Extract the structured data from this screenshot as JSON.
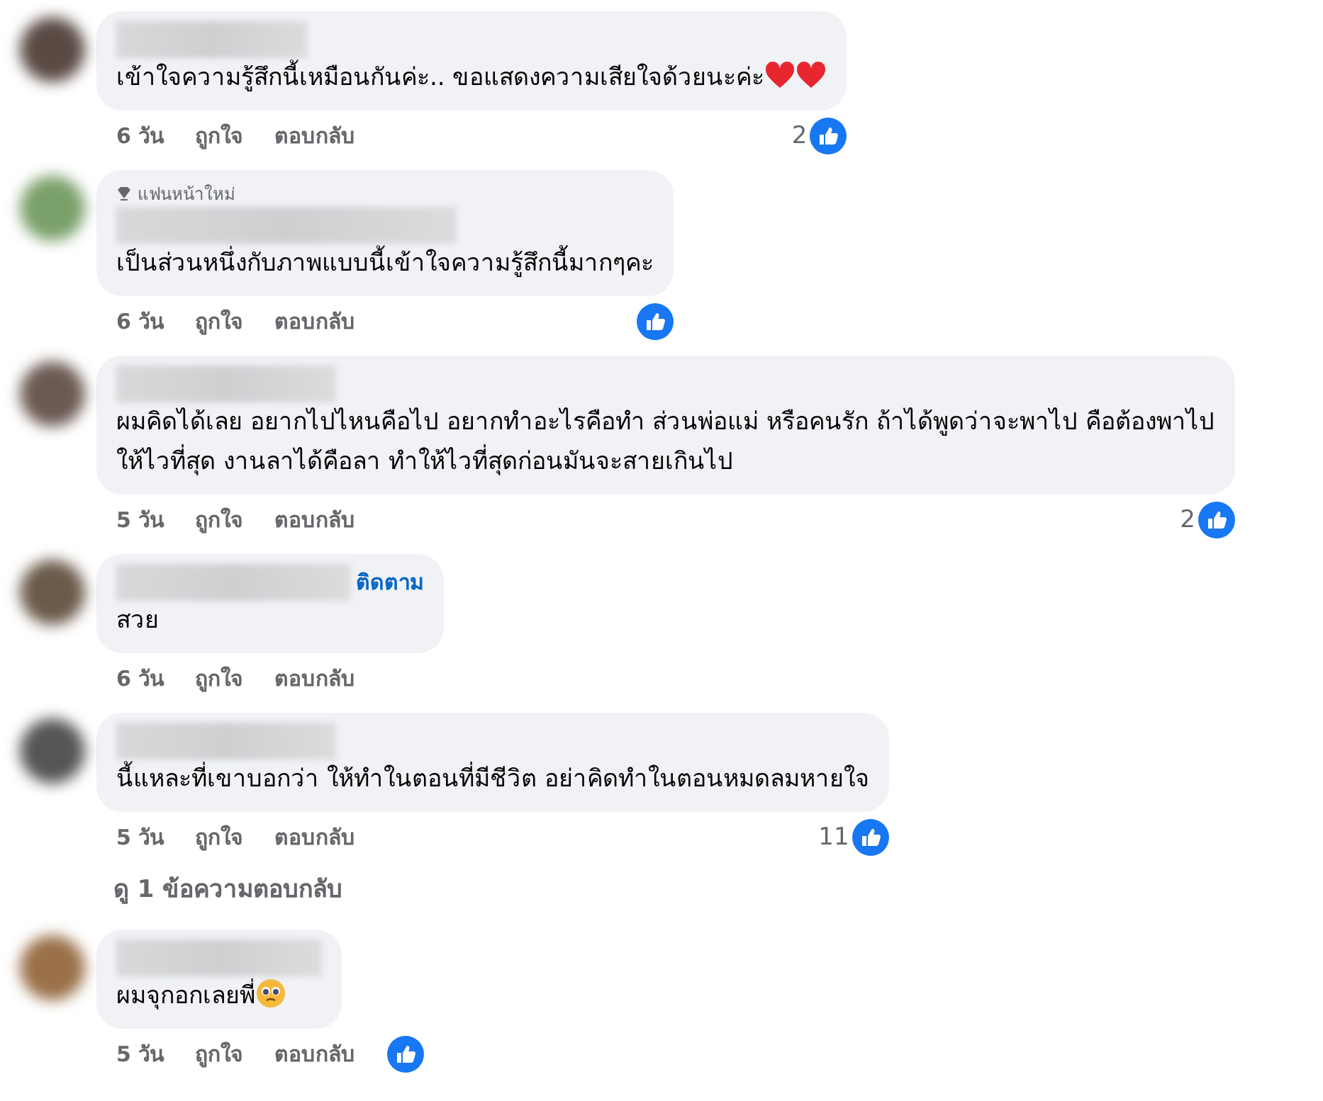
{
  "comments": [
    {
      "text": "เข้าใจความรู้สึกนี้เหมือนกันค่ะ.. ขอแสดงความเสียใจด้วยนะค่ะ",
      "emoji": [
        {
          "kind": "heart"
        },
        {
          "kind": "heart"
        }
      ],
      "time": "6 วัน",
      "like": "ถูกใจ",
      "reply": "ตอบกลับ",
      "like_count": "2",
      "like_icon": true
    },
    {
      "badge": "แฟนหน้าใหม่",
      "text": "เป็นส่วนหนึ่งกับภาพแบบนี้เข้าใจความรู้สึกนี้มากๆคะ",
      "time": "6 วัน",
      "like": "ถูกใจ",
      "reply": "ตอบกลับ",
      "like_icon": true
    },
    {
      "text": "ผมคิดได้เลย อยากไปไหนคือไป อยากทำอะไรคือทำ ส่วนพ่อแม่ หรือคนรัก ถ้าได้พูดว่าจะพาไป คือต้องพาไปให้ไวที่สุด งานลาได้คือลา ทำให้ไวที่สุดก่อนมันจะสายเกินไป",
      "time": "5 วัน",
      "like": "ถูกใจ",
      "reply": "ตอบกลับ",
      "like_count": "2",
      "like_icon": true
    },
    {
      "follow": "ติดตาม",
      "text": "สวย",
      "time": "6 วัน",
      "like": "ถูกใจ",
      "reply": "ตอบกลับ",
      "like_icon": false
    },
    {
      "text": "นี้แหละที่เขาบอกว่า ให้ทำในตอนที่มีชีวิต อย่าคิดทำในตอนหมดลมหายใจ",
      "time": "5 วัน",
      "like": "ถูกใจ",
      "reply": "ตอบกลับ",
      "like_count": "11",
      "like_icon": true,
      "view_replies": "ดู 1 ข้อความตอบกลับ"
    },
    {
      "text": "ผมจุกอกเลยพี่",
      "emoji": [
        {
          "kind": "teary-face"
        }
      ],
      "time": "5 วัน",
      "like": "ถูกใจ",
      "reply": "ตอบกลับ",
      "like_icon": true
    }
  ]
}
